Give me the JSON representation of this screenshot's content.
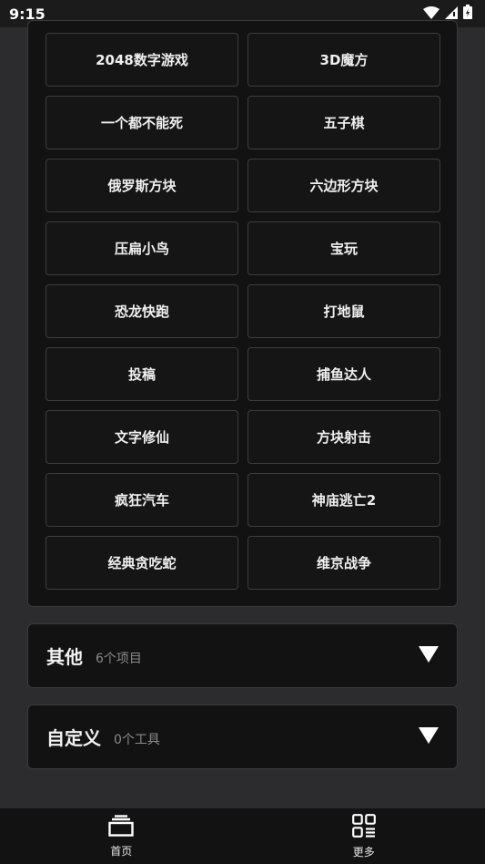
{
  "status_bar": {
    "time": "9:15",
    "icons": [
      "wifi-icon",
      "signal-icon",
      "battery-icon"
    ]
  },
  "games": [
    "2048数字游戏",
    "3D魔方",
    "一个都不能死",
    "五子棋",
    "俄罗斯方块",
    "六边形方块",
    "压扁小鸟",
    "宝玩",
    "恐龙快跑",
    "打地鼠",
    "投稿",
    "捕鱼达人",
    "文字修仙",
    "方块射击",
    "疯狂汽车",
    "神庙逃亡2",
    "经典贪吃蛇",
    "维京战争"
  ],
  "sections": [
    {
      "title": "其他",
      "count": "6个项目",
      "icon": "triangle-down-icon"
    },
    {
      "title": "自定义",
      "count": "0个工具",
      "icon": "triangle-down-icon"
    }
  ],
  "bottom_nav": [
    {
      "label": "首页",
      "icon": "home-tray-icon"
    },
    {
      "label": "更多",
      "icon": "grid-more-icon"
    }
  ],
  "colors": {
    "background": "#2c2c2e",
    "card": "#121212",
    "border": "#3d3d3d",
    "text": "#f0f0f0",
    "muted": "#8a8a8a"
  }
}
